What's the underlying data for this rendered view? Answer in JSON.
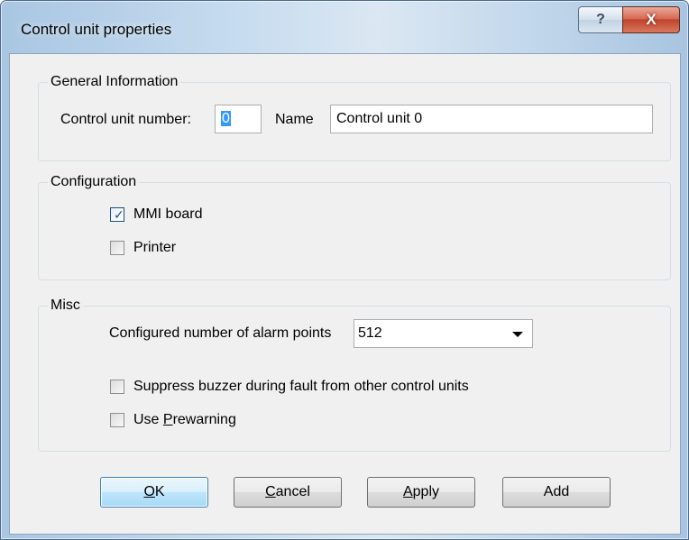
{
  "window": {
    "title": "Control unit properties",
    "help_glyph": "?",
    "close_glyph": "X"
  },
  "general": {
    "group_label": "General Information",
    "number_label": "Control unit number:",
    "number_value": "0",
    "name_label": "Name",
    "name_value": "Control unit 0"
  },
  "configuration": {
    "group_label": "Configuration",
    "mmi_board": {
      "label": "MMI board",
      "checked": true
    },
    "printer": {
      "label": "Printer",
      "checked": false
    }
  },
  "misc": {
    "group_label": "Misc",
    "alarm_points_label": "Configured number of alarm points",
    "alarm_points_value": "512",
    "suppress_buzzer": {
      "label": "Suppress buzzer during fault from other control units",
      "checked": false
    },
    "use_prewarning": {
      "label_pre": "Use ",
      "label_accel": "P",
      "label_post": "rewarning",
      "checked": false
    }
  },
  "buttons": {
    "ok": {
      "accel": "O",
      "rest": "K"
    },
    "cancel": {
      "accel": "C",
      "rest": "ancel"
    },
    "apply": {
      "accel": "A",
      "rest": "pply"
    },
    "add": {
      "label": "Add"
    }
  },
  "icons": {
    "help": "help-icon",
    "close": "close-icon",
    "check": "checkmark-icon",
    "dropdown": "chevron-down-icon"
  }
}
